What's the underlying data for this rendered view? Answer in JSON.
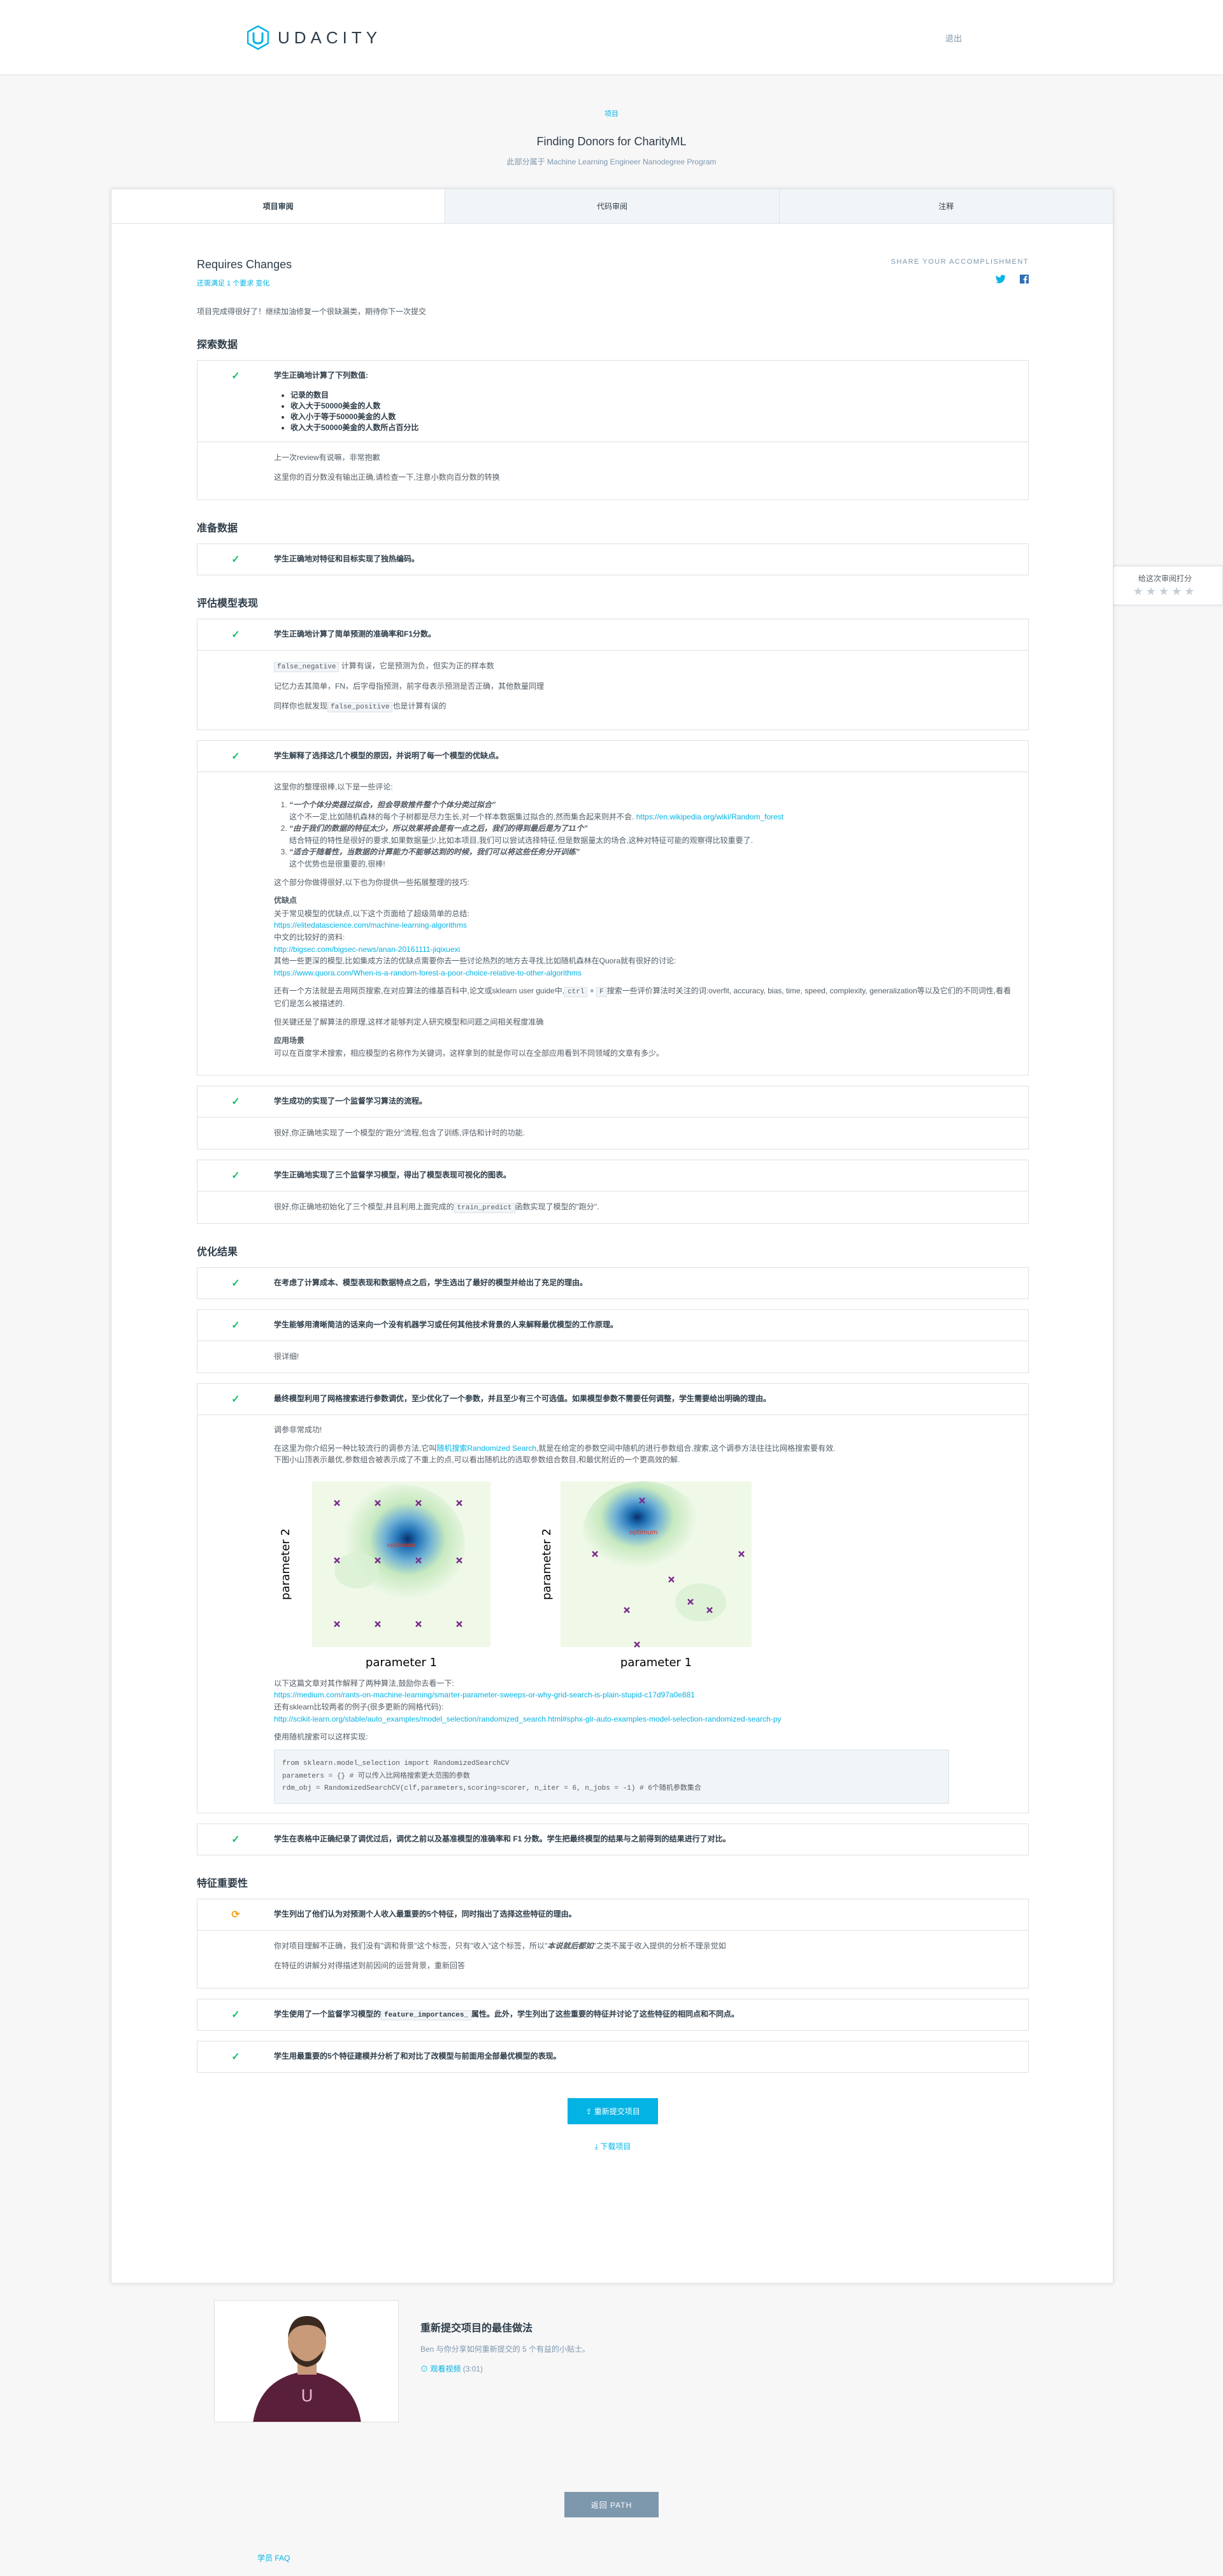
{
  "header": {
    "brand": "UDACITY",
    "logout": "退出"
  },
  "project": {
    "tag": "项目",
    "title": "Finding Donors for CharityML",
    "subtitle": "此部分属于 Machine Learning Engineer Nanodegree Program"
  },
  "tabs": [
    "项目审阅",
    "代码审阅",
    "注释"
  ],
  "review": {
    "status": "Requires Changes",
    "status_sub": "还需满足 1 个要求 变化",
    "share_label": "SHARE YOUR ACCOMPLISHMENT",
    "intro": "项目完成得很好了！继续加油修复一个很缺漏类，期待你下一次提交"
  },
  "sections": {
    "explore": "探索数据",
    "prep": "准备数据",
    "eval": "评估模型表现",
    "improve": "优化结果",
    "features": "特征重要性"
  },
  "rubrics": {
    "r1": {
      "title": "学生正确地计算了下列数值:",
      "bullets": [
        "记录的数目",
        "收入大于50000美金的人数",
        "收入小于等于50000美金的人数",
        "收入大于50000美金的人数所占百分比"
      ],
      "body": [
        "上一次review有说嘛，非常抱歉",
        "这里你的百分数没有输出正确,请检查一下,注意小数向百分数的转换"
      ]
    },
    "r2": {
      "title": "学生正确地对特征和目标实现了独热编码。"
    },
    "r3": {
      "title": "学生正确地计算了简单预测的准确率和F1分数。",
      "code1": "false_negative",
      "body1": "计算有误，它是预测为负，但实为正的样本数",
      "body2": "记忆力去其简单，FN，后字母指预测，前字母表示预测是否正确，其他数量同理",
      "body3a": "同样你也就发现",
      "code2": "false_positive",
      "body3b": "也是计算有误的"
    },
    "r4": {
      "title": "学生解释了选择这几个模型的原因，并说明了每一个模型的优缺点。",
      "lead": "这里你的整理很棒,以下是一些评论:",
      "q1": "“一个个体分类器过拟合，担会导致推件整个个体分类过拟合”",
      "q1b": "这个不一定,比如随机森林的每个子树都是尽力生长,对一个样本数据集过拟合的,然而集合起来则并不会.",
      "link1": "https://en.wikipedia.org/wiki/Random_forest",
      "q2": "“由于我们的数据的特征太少，所以效果将会是有一点之后，我们的得到最后是为了11个”",
      "q2b": "结合特征的特性是很好的要求,如果数据量少,比如本项目,我们可以尝试选择特征,但是数据量太的场合,这种对特征可能的观察得比较重要了.",
      "q3": "“适合于随着性，当数据的计算能力不能够达到的时候，我们可以将这些任务分开训练”",
      "q3b": "这个优势也是很重要的,很棒!",
      "mid": "这个部分你做得很好,以下也为你提供一些拓展整理的技巧:",
      "adv_title": "优缺点",
      "adv1": "关于常见模型的优缺点,以下这个页面给了超级简单的总结:",
      "link2": "https://elitedatascience.com/machine-learning-algorithms",
      "adv2": "中文的比较好的资料:",
      "link3": "http://bigsec.com/bigsec-news/anan-20161111-jiqixuexi",
      "adv3": "其他一些更深的模型,比如集成方法的优缺点需要你去一些讨论热烈的地方去寻找,比如随机森林在Quora就有很好的讨论:",
      "link4": "https://www.quora.com/When-is-a-random-forest-a-poor-choice-relative-to-other-algorithms",
      "adv4a": "还有一个方法就是去用网页搜索,在对应算法的维基百科中,论文或sklearn user guide中,",
      "code3": "ctrl",
      "code4": "F",
      "adv4b": "搜索一些评价算法时关注的词:overfit, accuracy, bias, time, speed, complexity, generalization等以及它们的不同词性,看看它们是怎么被描述的.",
      "adv5": "但关键还是了解算法的原理,这样才能够判定人研究模型和问题之间相关程度准确",
      "app_title": "应用场景",
      "app1": "可以在百度学术搜索，相应模型的名称作为关键词，这样拿到的就是你可以在全部应用看到不同领域的文章有多少。"
    },
    "r5": {
      "title": "学生成功的实现了一个监督学习算法的流程。",
      "body": "很好,你正确地实现了一个模型的\"跑分\"流程,包含了训练,评估和计时的功能."
    },
    "r6": {
      "title": "学生正确地实现了三个监督学习模型，得出了模型表现可视化的图表。",
      "body_a": "很好,你正确地初始化了三个模型,并且利用上面完成的",
      "code": "train_predict",
      "body_b": "函数实现了模型的\"跑分\"."
    },
    "r7": {
      "title": "在考虑了计算成本、模型表现和数据特点之后，学生选出了最好的模型并给出了充足的理由。"
    },
    "r8": {
      "title": "学生能够用清晰简洁的话来向一个没有机器学习或任何其他技术背景的人来解释最优模型的工作原理。",
      "body": "很详细!"
    },
    "r9": {
      "title": "最终模型利用了网格搜索进行参数调优，至少优化了一个参数，并且至少有三个可选值。如果模型参数不需要任何调整，学生需要给出明确的理由。",
      "body1": "调参非常成功!",
      "body2a": "在这里为你介绍另一种比较流行的调参方法,它叫",
      "link_rs": "随机搜索Randomized Search",
      "body2b": ",就是在给定的参数空间中随机的进行参数组合,搜索,这个调参方法往往比网格搜索要有效.",
      "body3": "下图小山顶表示最优,参数组合被表示成了不重上的点,可以看出随机比的选取参数组合数目,和最优附近的一个更高效的解.",
      "plot_xlabel": "parameter 1",
      "plot_ylabel": "parameter 2",
      "plot_optimum": "optimum",
      "body4": "以下这篇文章对其作解释了两种算法,鼓励你去看一下:",
      "link5": "https://medium.com/rants-on-machine-learning/smarter-parameter-sweeps-or-why-grid-search-is-plain-stupid-c17d97a0e881",
      "body5": "还有sklearn比较两者的例子(很多更新的网格代码):",
      "link6": "http://scikit-learn.org/stable/auto_examples/model_selection/randomized_search.html#sphx-glr-auto-examples-model-selection-randomized-search-py",
      "body6": "使用随机搜索可以这样实现:",
      "code_l1": "from sklearn.model_selection import RandomizedSearchCV",
      "code_l2": "parameters = {} # 可以传入比网格搜索更大范围的参数",
      "code_l3": "rdm_obj = RandomizedSearchCV(clf,parameters,scoring=scorer, n_iter = 6, n_jobs = -1) # 6个随机参数集合"
    },
    "r10": {
      "title": "学生在表格中正确纪录了调优过后，调优之前以及基准模型的准确率和 F1 分数。学生把最终模型的结果与之前得到的结果进行了对比。"
    },
    "r11": {
      "title": "学生列出了他们认为对预测个人收入最重要的5个特征，同时指出了选择这些特征的理由。",
      "body1a": "你对项目理解不正确，我们没有\"调和背景\"这个标签，只有\"收入\"这个标签，所以\"",
      "body1_em": "本说就后都如",
      "body1b": "\"之类不属于收入提供的分析不理亲觉如",
      "body2": "在特征的讲解分对得描述到前因间的运营背景，重新回答"
    },
    "r12": {
      "title_a": "学生使用了一个监督学习模型的",
      "code": "feature_importances_",
      "title_b": "属性。此外，学生列出了这些重要的特征并讨论了这些特征的相同点和不同点。"
    },
    "r13": {
      "title": "学生用最重要的5个特征建模并分析了和对比了改模型与前面用全部最优模型的表现。"
    }
  },
  "actions": {
    "resubmit": "重新提交项目",
    "download": "下载项目"
  },
  "tip": {
    "title": "重新提交项目的最佳做法",
    "desc": "Ben 与你分享如何重新提交的 5 个有益的小贴士。",
    "link": "观看视频",
    "duration": "(3:01)"
  },
  "rate": {
    "label": "给这次审阅打分"
  },
  "footer": {
    "back": "返回 PATH",
    "faq": "学员 FAQ"
  },
  "colors": {
    "accent": "#02b3e4",
    "pass": "#15c26b",
    "warn": "#f5a623"
  }
}
